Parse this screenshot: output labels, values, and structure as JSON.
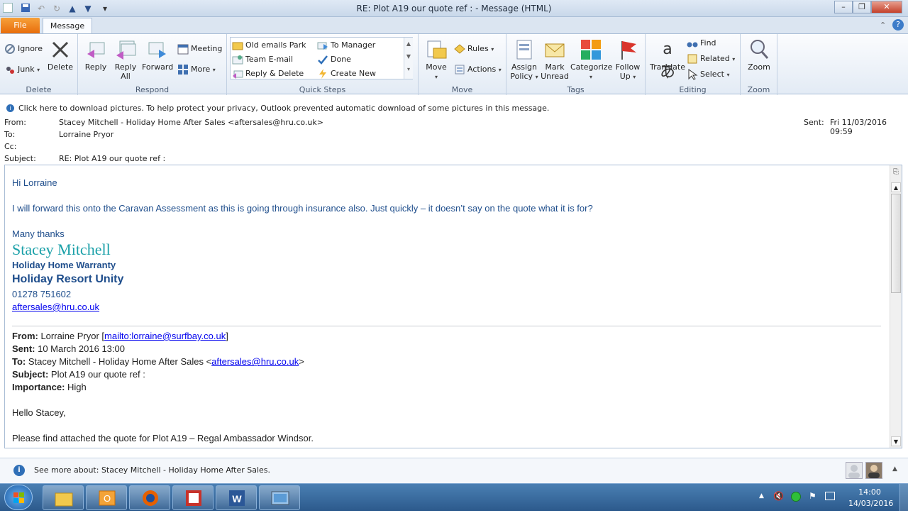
{
  "window": {
    "title": "RE: Plot A19  our quote ref :  -  Message (HTML)"
  },
  "ribbon": {
    "tabs": {
      "file": "File",
      "message": "Message"
    },
    "delete_group": {
      "ignore": "Ignore",
      "junk": "Junk",
      "delete": "Delete",
      "label": "Delete"
    },
    "respond_group": {
      "reply": "Reply",
      "reply_all_1": "Reply",
      "reply_all_2": "All",
      "forward": "Forward",
      "meeting": "Meeting",
      "more": "More",
      "label": "Respond"
    },
    "quick_steps": {
      "items": [
        "Old emails Park",
        "To Manager",
        "Team E-mail",
        "Done",
        "Reply & Delete",
        "Create New"
      ],
      "label": "Quick Steps"
    },
    "move_group": {
      "move": "Move",
      "rules": "Rules",
      "actions": "Actions",
      "label": "Move"
    },
    "tags_group": {
      "assign_1": "Assign",
      "assign_2": "Policy",
      "mark_1": "Mark",
      "mark_2": "Unread",
      "categorize": "Categorize",
      "follow_1": "Follow",
      "follow_2": "Up",
      "label": "Tags"
    },
    "editing_group": {
      "translate": "Translate",
      "find": "Find",
      "related": "Related",
      "select": "Select",
      "label": "Editing"
    },
    "zoom_group": {
      "zoom": "Zoom",
      "label": "Zoom"
    }
  },
  "infobar": {
    "text": "Click here to download pictures. To help protect your privacy, Outlook prevented automatic download of some pictures in this message."
  },
  "header": {
    "from_label": "From:",
    "from_value": "Stacey Mitchell - Holiday Home After Sales <aftersales@hru.co.uk>",
    "to_label": "To:",
    "to_value": "Lorraine Pryor",
    "cc_label": "Cc:",
    "subject_label": "Subject:",
    "subject_value": "RE: Plot A19  our quote ref :",
    "sent_label": "Sent:",
    "sent_value": "Fri 11/03/2016 09:59"
  },
  "body": {
    "greeting": "Hi Lorraine",
    "para1": "I will forward this onto the Caravan Assessment as this is going through insurance also. Just quickly – it doesn’t say on the quote what it is for?",
    "thanks": "Many thanks",
    "sig_name": "Stacey Mitchell",
    "sig_role": "Holiday Home Warranty",
    "sig_company": "Holiday Resort Unity",
    "sig_phone": "01278 751602",
    "sig_email": "aftersales@hru.co.uk",
    "q_from_label": "From:",
    "q_from_value": " Lorraine Pryor [",
    "q_from_link": "mailto:lorraine@surfbay.co.uk",
    "q_from_end": "]",
    "q_sent_label": "Sent:",
    "q_sent_value": " 10 March 2016 13:00",
    "q_to_label": "To:",
    "q_to_value": " Stacey Mitchell - Holiday Home After Sales <",
    "q_to_link": "aftersales@hru.co.uk",
    "q_to_end": ">",
    "q_subject_label": "Subject:",
    "q_subject_value": " Plot A19 our quote ref :",
    "q_importance_label": "Importance:",
    "q_importance_value": " High",
    "hello": "Hello Stacey,",
    "para2": "Please find attached the quote for Plot A19 – Regal Ambassador Windsor."
  },
  "people_pane": {
    "text": "See more about: Stacey Mitchell - Holiday Home After Sales."
  },
  "taskbar": {
    "time": "14:00",
    "date": "14/03/2016"
  },
  "colors": {
    "signature_teal": "#1aa0a8",
    "body_blue": "#1f4e8c",
    "file_tab": "#e86d0b"
  }
}
